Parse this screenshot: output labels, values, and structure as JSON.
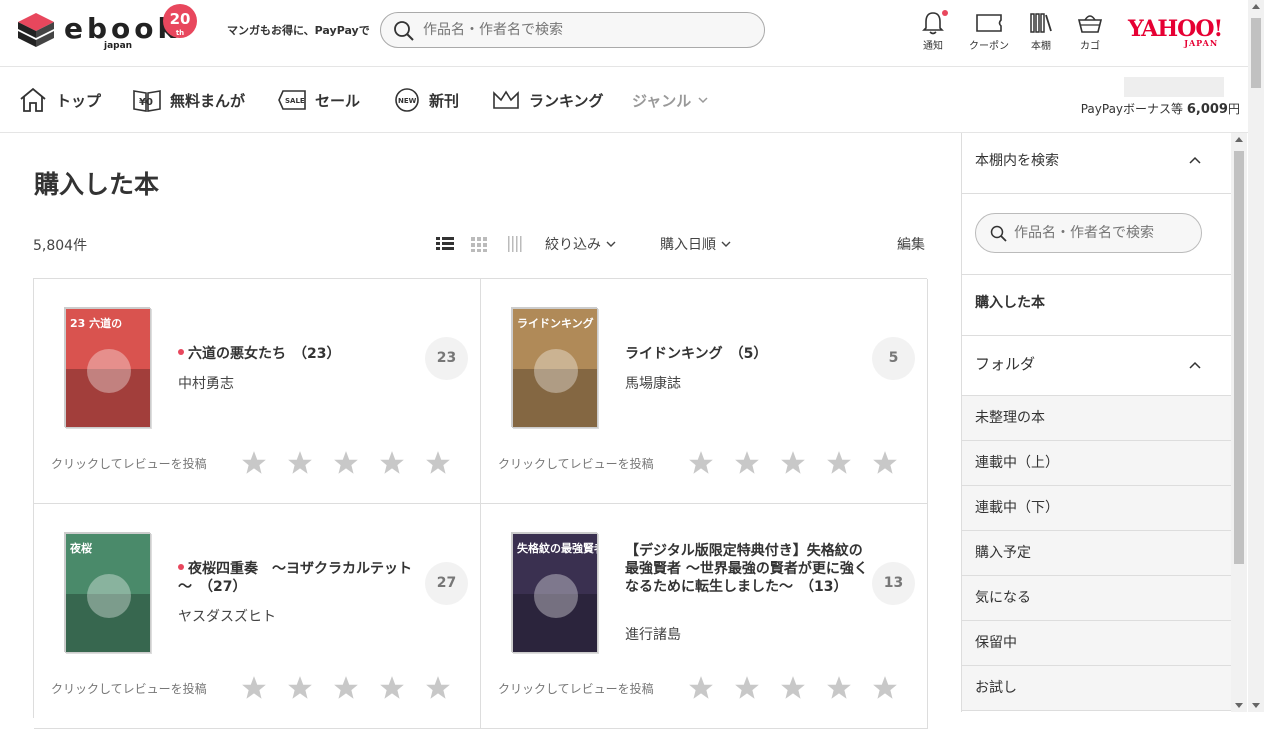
{
  "header": {
    "logo_text": "ebook",
    "logo_sub": "japan",
    "anniversary": "20",
    "anniversary_sub": "th",
    "tagline": "マンガもお得に、PayPayで",
    "search_placeholder": "作品名・作者名で検索",
    "icons": [
      {
        "label": "通知",
        "icon": "bell-icon"
      },
      {
        "label": "クーポン",
        "icon": "coupon-icon"
      },
      {
        "label": "本棚",
        "icon": "bookshelf-icon"
      },
      {
        "label": "カゴ",
        "icon": "cart-icon"
      }
    ],
    "yahoo_main": "YAHOO!",
    "yahoo_sub": "JAPAN"
  },
  "nav": {
    "items": [
      {
        "label": "トップ",
        "icon": "home-icon"
      },
      {
        "label": "無料まんが",
        "icon": "free-manga-icon"
      },
      {
        "label": "セール",
        "icon": "sale-icon"
      },
      {
        "label": "新刊",
        "icon": "new-icon"
      },
      {
        "label": "ランキング",
        "icon": "crown-icon"
      },
      {
        "label": "ジャンル",
        "icon": "chevron-down-icon"
      }
    ],
    "paypay_label": "PayPayボーナス等",
    "paypay_amount": "6,009",
    "paypay_unit": "円"
  },
  "main": {
    "title": "購入した本",
    "count": "5,804件",
    "filter_label": "絞り込み",
    "sort_label": "購入日順",
    "edit_label": "編集",
    "review_prompt": "クリックしてレビューを投稿",
    "books": [
      {
        "title": "六道の悪女たち　（23）",
        "author": "中村勇志",
        "volume": "23",
        "new": true,
        "cover_text": "23 六道の",
        "cover_color": "#d9534f"
      },
      {
        "title": "ライドンキング　（5）",
        "author": "馬場康誌",
        "volume": "5",
        "new": false,
        "cover_text": "ライドンキング",
        "cover_color": "#b08a58"
      },
      {
        "title": "夜桜四重奏　～ヨザクラカルテット～　（27）",
        "author": "ヤスダスズヒト",
        "volume": "27",
        "new": true,
        "cover_text": "夜桜",
        "cover_color": "#4a8a6a"
      },
      {
        "title": "【デジタル版限定特典付き】失格紋の最強賢者 ～世界最強の賢者が更に強くなるために転生しました～　（13）",
        "author": "進行諸島",
        "volume": "13",
        "new": false,
        "cover_text": "失格紋の最強賢者",
        "cover_color": "#3a3050"
      }
    ]
  },
  "sidebar": {
    "search_title": "本棚内を検索",
    "search_placeholder": "作品名・作者名で検索",
    "purchased": "購入した本",
    "folder_title": "フォルダ",
    "folders": [
      "未整理の本",
      "連載中（上）",
      "連載中（下）",
      "購入予定",
      "気になる",
      "保留中",
      "お試し"
    ]
  },
  "colors": {
    "accent": "#e8475d",
    "yahoo": "#e60033"
  }
}
